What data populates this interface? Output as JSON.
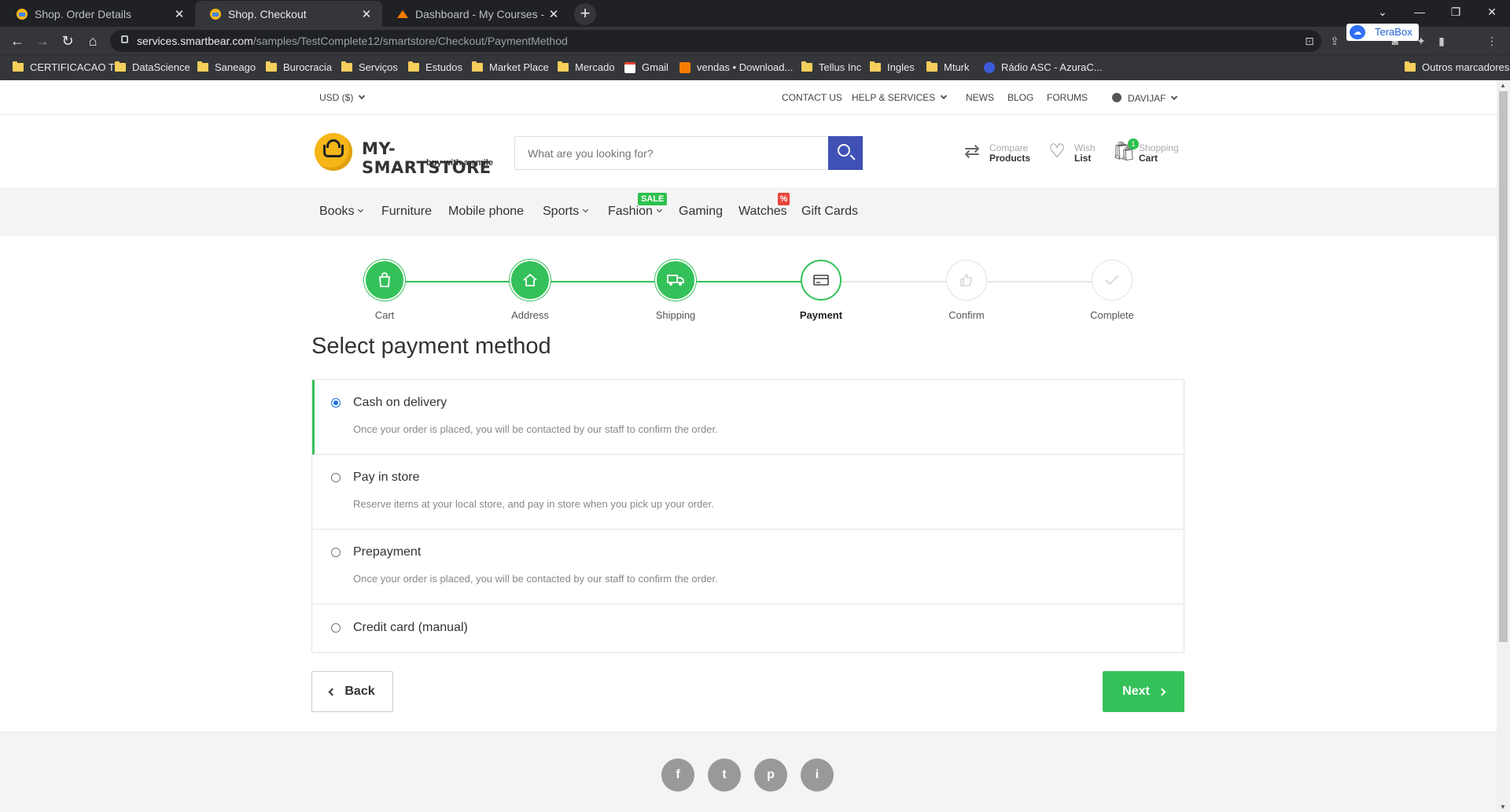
{
  "browser": {
    "tabs": [
      {
        "title": "Shop. Order Details",
        "active": false
      },
      {
        "title": "Shop. Checkout",
        "active": true
      },
      {
        "title": "Dashboard - My Courses - Detail",
        "active": false
      }
    ],
    "new_tab_label": "+",
    "url_host": "services.smartbear.com",
    "url_path": "/samples/TestComplete12/smartstore/Checkout/PaymentMethod",
    "extension_label": "TeraBox",
    "bookmarks": [
      {
        "label": "CERTIFICACAO TI",
        "type": "folder"
      },
      {
        "label": "DataScience",
        "type": "folder"
      },
      {
        "label": "Saneago",
        "type": "folder"
      },
      {
        "label": "Burocracia",
        "type": "folder"
      },
      {
        "label": "Serviços",
        "type": "folder"
      },
      {
        "label": "Estudos",
        "type": "folder"
      },
      {
        "label": "Market Place",
        "type": "folder"
      },
      {
        "label": "Mercado",
        "type": "folder"
      },
      {
        "label": "Gmail",
        "type": "gmail"
      },
      {
        "label": "vendas • Download...",
        "type": "site"
      },
      {
        "label": "Tellus Inc",
        "type": "folder"
      },
      {
        "label": "Ingles",
        "type": "folder"
      },
      {
        "label": "Mturk",
        "type": "folder"
      },
      {
        "label": "Rádio ASC - AzuraC...",
        "type": "site2"
      }
    ],
    "other_bookmarks": "Outros marcadores"
  },
  "topbar": {
    "currency": "USD  ($)",
    "contact": "CONTACT US",
    "help": "HELP & SERVICES",
    "news": "NEWS",
    "blog": "BLOG",
    "forums": "FORUMS",
    "user": "DAVIJAF"
  },
  "header": {
    "logo_name": "MY-SMARTSTORE",
    "logo_tag": "buy with a smile",
    "search_placeholder": "What are you looking for?",
    "compare_l1": "Compare",
    "compare_l2": "Products",
    "wish_l1": "Wish",
    "wish_l2": "List",
    "cart_l1": "Shopping",
    "cart_l2": "Cart",
    "cart_count": "1"
  },
  "menu": {
    "items": [
      "Books",
      "Furniture",
      "Mobile phone",
      "Sports",
      "Fashion",
      "Gaming",
      "Watches",
      "Gift Cards"
    ],
    "sale_label": "SALE",
    "pct_label": "%"
  },
  "steps": [
    {
      "label": "Cart",
      "state": "done",
      "icon": "cart-icon"
    },
    {
      "label": "Address",
      "state": "done",
      "icon": "home-icon"
    },
    {
      "label": "Shipping",
      "state": "done",
      "icon": "truck-icon"
    },
    {
      "label": "Payment",
      "state": "current",
      "icon": "credit-card-icon"
    },
    {
      "label": "Confirm",
      "state": "todo",
      "icon": "thumbs-up-icon"
    },
    {
      "label": "Complete",
      "state": "todo",
      "icon": "check-icon"
    }
  ],
  "checkout": {
    "title": "Select payment method",
    "methods": [
      {
        "name": "Cash on delivery",
        "desc": "Once your order is placed, you will be contacted by our staff to confirm the order.",
        "selected": true
      },
      {
        "name": "Pay in store",
        "desc": "Reserve items at your local store, and pay in store when you pick up your order.",
        "selected": false
      },
      {
        "name": "Prepayment",
        "desc": "Once your order is placed, you will be contacted by our staff to confirm the order.",
        "selected": false
      },
      {
        "name": "Credit card (manual)",
        "desc": "",
        "selected": false
      }
    ],
    "back_label": "Back",
    "next_label": "Next"
  },
  "footer": {
    "social": [
      "f",
      "t",
      "p",
      "i"
    ]
  },
  "colors": {
    "accent_green": "#35c15a",
    "search_blue": "#3f51b5",
    "sale_red": "#e8453c"
  }
}
